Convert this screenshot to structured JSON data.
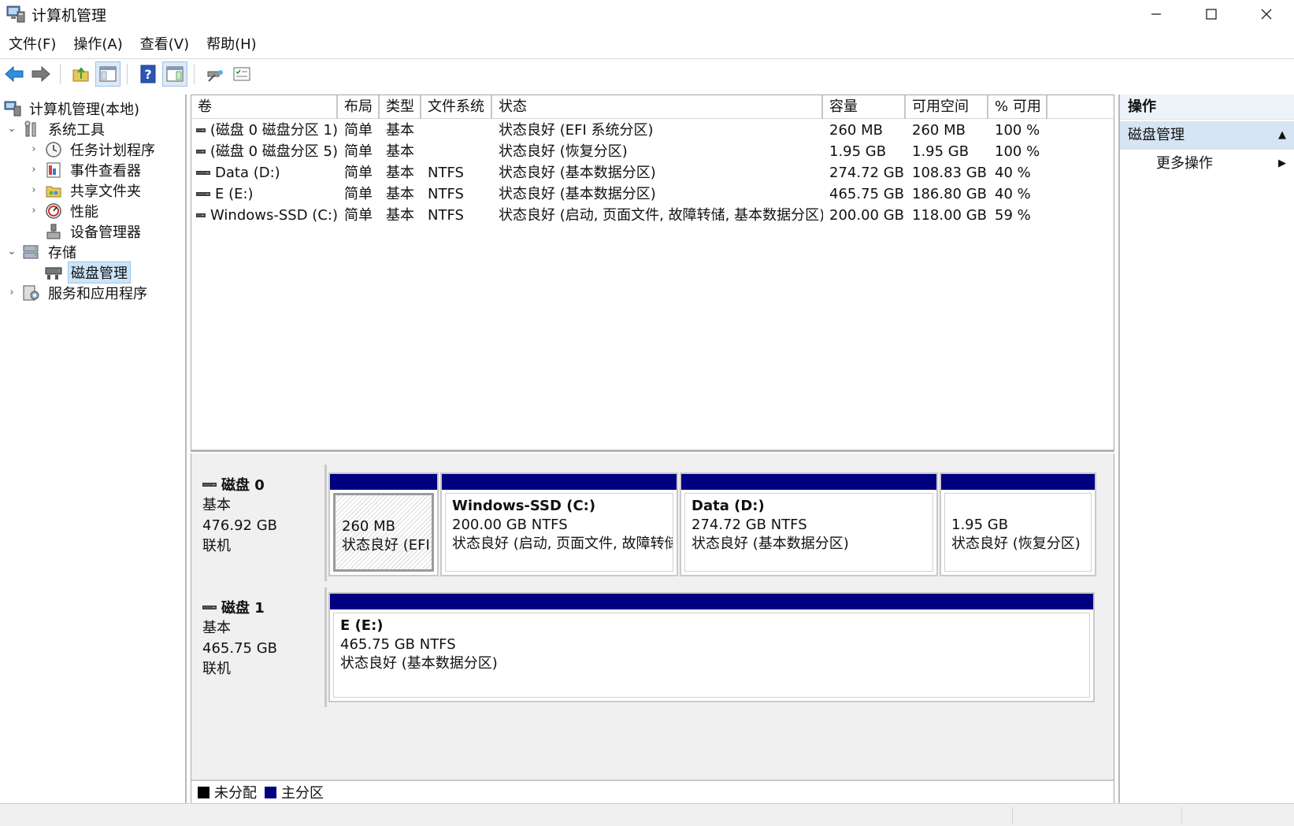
{
  "window": {
    "title": "计算机管理",
    "minimize_icon": "minimize-icon",
    "maximize_icon": "maximize-icon",
    "close_icon": "close-icon"
  },
  "menu": [
    "文件(F)",
    "操作(A)",
    "查看(V)",
    "帮助(H)"
  ],
  "toolbar": [
    "back-arrow-icon",
    "forward-arrow-icon",
    "up-folder-icon",
    "show-hide-console-tree-icon",
    "help-icon",
    "show-action-pane-icon",
    "connect-icon",
    "properties-icon"
  ],
  "tree": {
    "root": "计算机管理(本地)",
    "system_tools": "系统工具",
    "task_scheduler": "任务计划程序",
    "event_viewer": "事件查看器",
    "shared_folders": "共享文件夹",
    "performance": "性能",
    "device_manager": "设备管理器",
    "storage": "存储",
    "disk_management": "磁盘管理",
    "services_apps": "服务和应用程序"
  },
  "volumes": {
    "columns": [
      "卷",
      "布局",
      "类型",
      "文件系统",
      "状态",
      "容量",
      "可用空间",
      "% 可用"
    ],
    "rows": [
      {
        "vol": "(磁盘 0 磁盘分区 1)",
        "layout": "简单",
        "type": "基本",
        "fs": "",
        "status": "状态良好 (EFI 系统分区)",
        "capacity": "260 MB",
        "free": "260 MB",
        "pct": "100 %"
      },
      {
        "vol": "(磁盘 0 磁盘分区 5)",
        "layout": "简单",
        "type": "基本",
        "fs": "",
        "status": "状态良好 (恢复分区)",
        "capacity": "1.95 GB",
        "free": "1.95 GB",
        "pct": "100 %"
      },
      {
        "vol": "Data (D:)",
        "layout": "简单",
        "type": "基本",
        "fs": "NTFS",
        "status": "状态良好 (基本数据分区)",
        "capacity": "274.72 GB",
        "free": "108.83 GB",
        "pct": "40 %"
      },
      {
        "vol": "E (E:)",
        "layout": "简单",
        "type": "基本",
        "fs": "NTFS",
        "status": "状态良好 (基本数据分区)",
        "capacity": "465.75 GB",
        "free": "186.80 GB",
        "pct": "40 %"
      },
      {
        "vol": "Windows-SSD (C:)",
        "layout": "简单",
        "type": "基本",
        "fs": "NTFS",
        "status": "状态良好 (启动, 页面文件, 故障转储, 基本数据分区)",
        "capacity": "200.00 GB",
        "free": "118.00 GB",
        "pct": "59 %"
      }
    ]
  },
  "disks": {
    "disk0": {
      "name": "磁盘 0",
      "type": "基本",
      "size": "476.92 GB",
      "state": "联机",
      "partitions": [
        {
          "title": "",
          "size": "260 MB",
          "status": "状态良好 (EFI 系统分区)"
        },
        {
          "title": "Windows-SSD  (C:)",
          "size": "200.00 GB NTFS",
          "status": "状态良好 (启动, 页面文件, 故障转储, 基本数据分区)"
        },
        {
          "title": "Data  (D:)",
          "size": "274.72 GB NTFS",
          "status": "状态良好 (基本数据分区)"
        },
        {
          "title": "",
          "size": "1.95 GB",
          "status": "状态良好 (恢复分区)"
        }
      ]
    },
    "disk1": {
      "name": "磁盘 1",
      "type": "基本",
      "size": "465.75 GB",
      "state": "联机",
      "partitions": [
        {
          "title": "E  (E:)",
          "size": "465.75 GB NTFS",
          "status": "状态良好 (基本数据分区)"
        }
      ]
    }
  },
  "legend": {
    "unallocated": "未分配",
    "primary": "主分区",
    "unallocated_color": "#000000",
    "primary_color": "#000080"
  },
  "actions": {
    "header": "操作",
    "selected": "磁盘管理",
    "more": "更多操作"
  }
}
